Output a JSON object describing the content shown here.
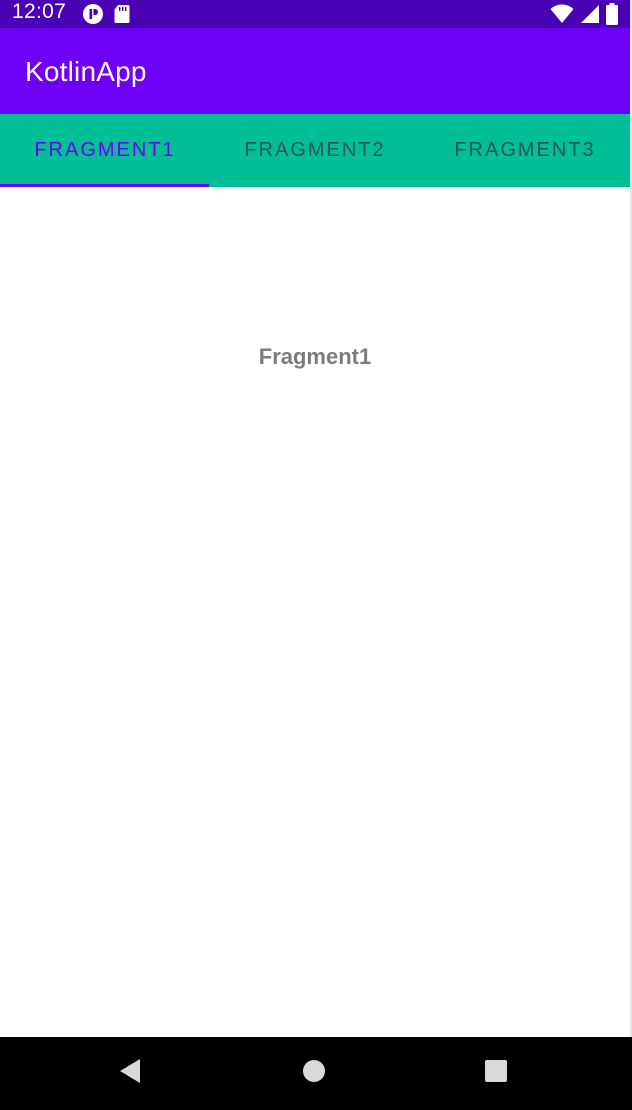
{
  "status_bar": {
    "time": "12:07",
    "icons": [
      "app-notification-icon",
      "sd-card-icon",
      "wifi-icon",
      "signal-icon",
      "battery-icon"
    ]
  },
  "app_bar": {
    "title": "KotlinApp"
  },
  "tabs": [
    {
      "label": "FRAGMENT1",
      "selected": true
    },
    {
      "label": "FRAGMENT2",
      "selected": false
    },
    {
      "label": "FRAGMENT3",
      "selected": false
    }
  ],
  "content": {
    "text": "Fragment1"
  },
  "nav_bar": {
    "icons": [
      "back-icon",
      "home-icon",
      "recents-icon"
    ]
  },
  "colors": {
    "status_bar": "#4a00b5",
    "app_bar": "#6f00f6",
    "tab_bar": "#00bf96",
    "tab_active_text": "#6f00f6",
    "tab_inactive_text": "#1f5a4b",
    "content_text": "#7c7c7c",
    "nav_bar": "#000000"
  }
}
